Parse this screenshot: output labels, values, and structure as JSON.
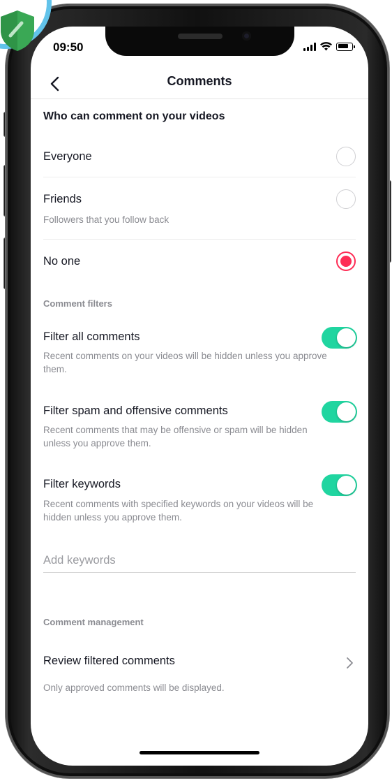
{
  "status_bar": {
    "time": "09:50"
  },
  "header": {
    "title": "Comments"
  },
  "who_can_comment": {
    "heading": "Who can comment on your videos",
    "options": [
      {
        "label": "Everyone",
        "description": "",
        "selected": false
      },
      {
        "label": "Friends",
        "description": "Followers that you follow back",
        "selected": false
      },
      {
        "label": "No one",
        "description": "",
        "selected": true
      }
    ]
  },
  "comment_filters": {
    "heading": "Comment filters",
    "items": [
      {
        "label": "Filter all comments",
        "description": "Recent comments on your videos will be hidden unless you approve them.",
        "enabled": true
      },
      {
        "label": "Filter spam and offensive comments",
        "description": "Recent comments that may be offensive or spam will be hidden unless you approve them.",
        "enabled": true
      },
      {
        "label": "Filter keywords",
        "description": "Recent comments with specified keywords on your videos will be hidden unless you approve them.",
        "enabled": true
      }
    ],
    "keyword_input": {
      "value": "",
      "placeholder": "Add keywords"
    }
  },
  "comment_management": {
    "heading": "Comment management",
    "review_label": "Review filtered comments",
    "review_description": "Only approved comments will be displayed."
  },
  "colors": {
    "accent_selected": "#fe2c55",
    "toggle_on": "#20d5a0",
    "shield": "#3aa855",
    "badge_ring": "#62c3ea"
  },
  "icons": {
    "back": "chevron-left-icon",
    "review": "chevron-right-icon",
    "badge": "shield-check-icon"
  }
}
